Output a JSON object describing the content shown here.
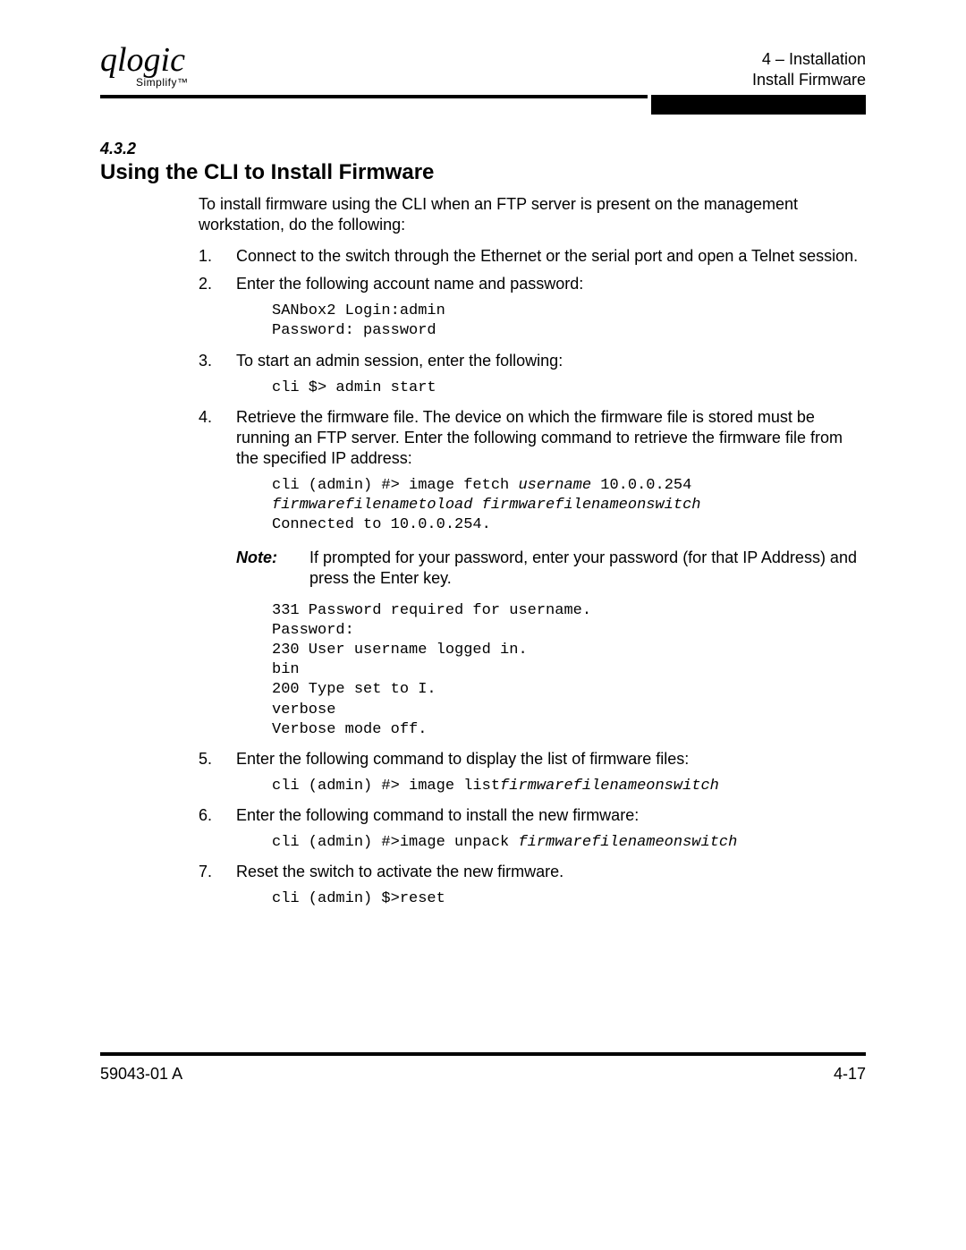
{
  "header": {
    "logo_script": "qlogic",
    "logo_simplify": "Simplify™",
    "chapter_line": "4 – Installation",
    "section_line": "Install Firmware"
  },
  "section": {
    "number": "4.3.2",
    "title": "Using the CLI to Install Firmware",
    "intro": "To install firmware using the CLI when an FTP server is present on the management workstation, do the following:"
  },
  "steps": {
    "s1_num": "1.",
    "s1_text": "Connect to the switch through the Ethernet or the serial port and open a Telnet session.",
    "s2_num": "2.",
    "s2_text": "Enter the following account name and password:",
    "s2_code": "SANbox2 Login:admin\nPassword: password",
    "s3_num": "3.",
    "s3_text": "To start an admin session, enter the following:",
    "s3_code": "cli $> admin start",
    "s4_num": "4.",
    "s4_text": "Retrieve the firmware file. The device on which the firmware file is stored must be running an FTP server. Enter the following command to retrieve the firmware file from the specified IP address:",
    "s4_code_p1": "cli (admin) #> image fetch ",
    "s4_code_i1": "username",
    "s4_code_p2": " 10.0.0.254 ",
    "s4_code_i2": "firmwarefilenametoload firmwarefilenameonswitch",
    "s4_code_p3": "\nConnected to 10.0.0.254.",
    "note_label": "Note:",
    "note_text": "If prompted for your password, enter your password (for that IP Address) and press the Enter key.",
    "s4_code2": "331 Password required for username.\nPassword:\n230 User username logged in.\nbin\n200 Type set to I.\nverbose\nVerbose mode off.",
    "s5_num": "5.",
    "s5_text": "Enter the following command to display the list of firmware files:",
    "s5_code_p1": "cli (admin) #> image list",
    "s5_code_i1": "firmwarefilenameonswitch",
    "s6_num": "6.",
    "s6_text": "Enter the following command to install the new firmware:",
    "s6_code_p1": "cli (admin) #>image unpack ",
    "s6_code_i1": "firmwarefilenameonswitch",
    "s7_num": "7.",
    "s7_text": "Reset the switch to activate the new firmware.",
    "s7_code": "cli (admin) $>reset"
  },
  "footer": {
    "doc_id": "59043-01 A",
    "page_num": "4-17"
  }
}
